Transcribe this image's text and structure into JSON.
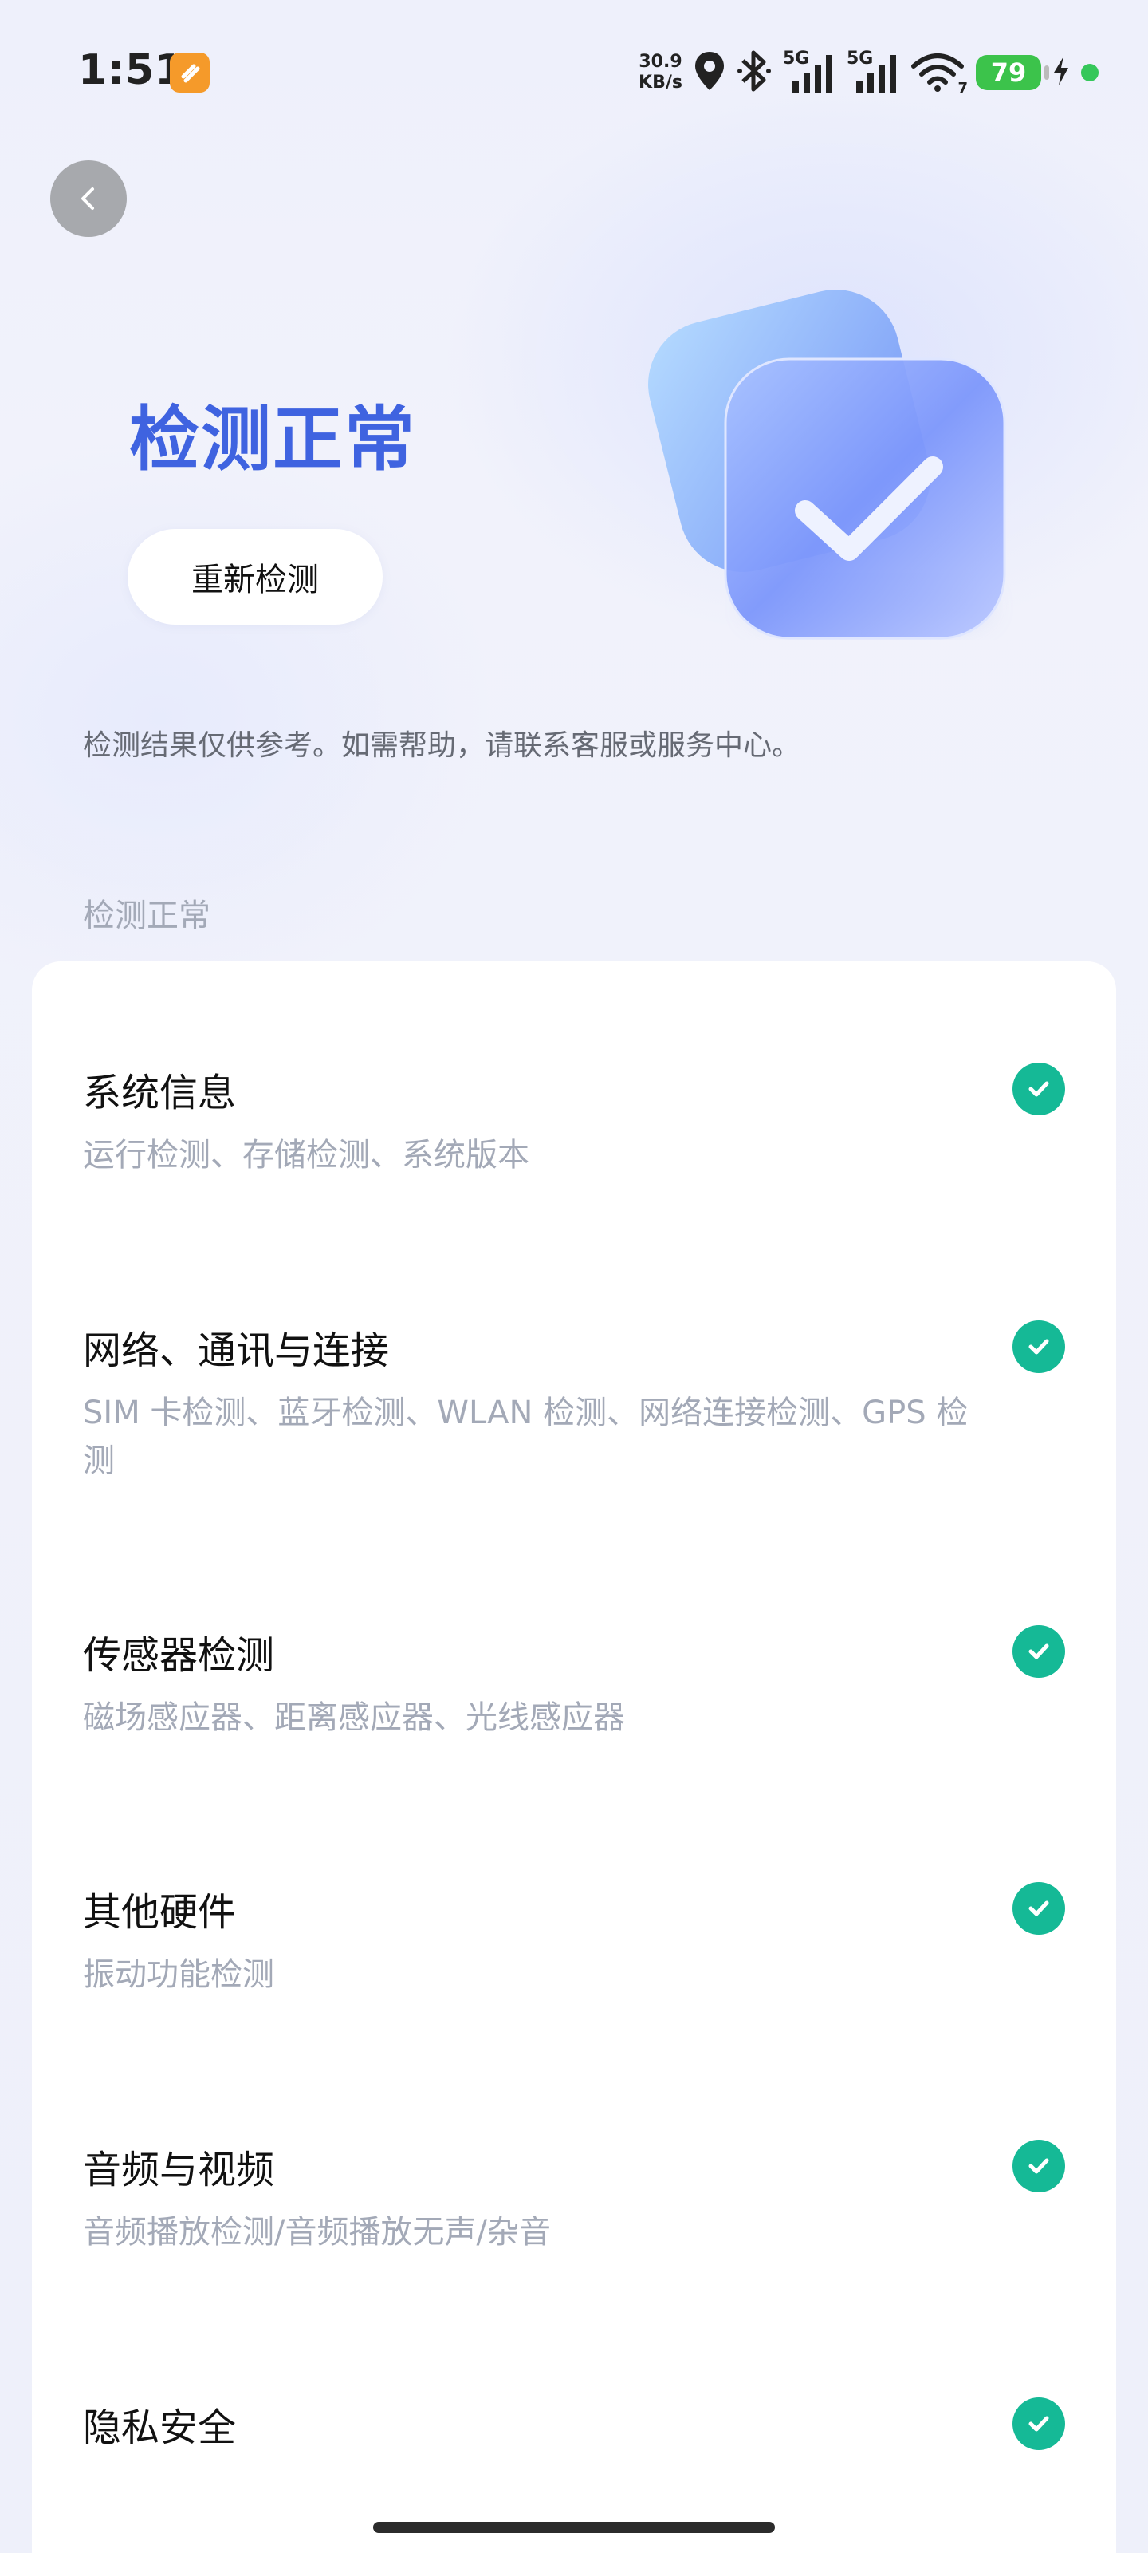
{
  "status_bar": {
    "time": "1:51",
    "net_speed_value": "30.9",
    "net_speed_unit": "KB/s",
    "signal_label_1": "5G",
    "signal_label_2": "5G",
    "wifi_label": "7",
    "battery_level": "79",
    "icons": [
      "app-badge-icon",
      "location-icon",
      "bluetooth-icon",
      "signal-icon",
      "signal-icon",
      "wifi-icon",
      "charging-icon"
    ]
  },
  "header": {
    "back_icon": "chevron-left-icon",
    "title": "检测正常",
    "recheck_label": "重新检测",
    "disclaimer": "检测结果仅供参考。如需帮助，请联系客服或服务中心。"
  },
  "section": {
    "label": "检测正常"
  },
  "items": [
    {
      "title": "系统信息",
      "subtitle": "运行检测、存储检测、系统版本",
      "status": "passed"
    },
    {
      "title": "网络、通讯与连接",
      "subtitle": "SIM 卡检测、蓝牙检测、WLAN 检测、网络连接检测、GPS 检测",
      "status": "passed"
    },
    {
      "title": "传感器检测",
      "subtitle": "磁场感应器、距离感应器、光线感应器",
      "status": "passed"
    },
    {
      "title": "其他硬件",
      "subtitle": "振动功能检测",
      "status": "passed"
    },
    {
      "title": "音频与视频",
      "subtitle": "音频播放检测/音频播放无声/杂音",
      "status": "passed"
    },
    {
      "title": "隐私安全",
      "subtitle": "",
      "status": "passed"
    }
  ],
  "colors": {
    "accent": "#3f63e0",
    "success": "#15b996",
    "subtext": "#a3a9b7",
    "battery": "#3cc34b"
  }
}
